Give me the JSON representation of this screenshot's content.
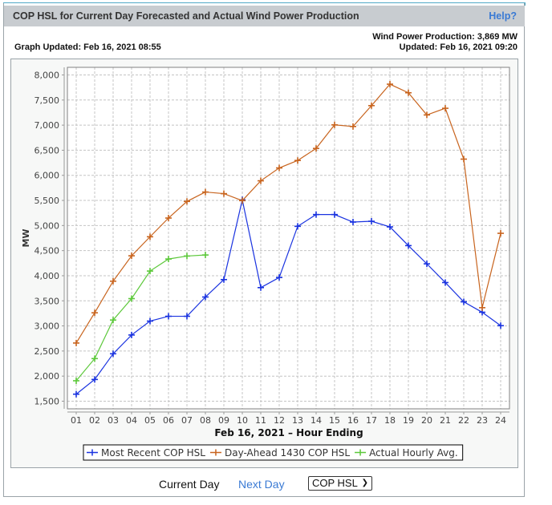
{
  "header": {
    "title": "COP HSL for Current Day Forecasted and Actual Wind Power Production",
    "help_label": "Help?"
  },
  "info": {
    "graph_updated": "Graph Updated: Feb 16, 2021 08:55",
    "wind_production": "Wind Power Production: 3,869 MW",
    "production_updated": "Updated: Feb 16, 2021 09:20"
  },
  "colors": {
    "header_bg": "#c8ccd0",
    "accent_strip": "#4fa8c5",
    "link": "#3a7ad4",
    "series_most_recent": "#1a33e0",
    "series_day_ahead": "#c8641e",
    "series_actual": "#5cc83a"
  },
  "nav": {
    "current_day": "Current Day",
    "next_day": "Next Day",
    "select_value": "COP HSL",
    "select_icon": "chevron-down-icon"
  },
  "chart_data": {
    "type": "line",
    "title": "",
    "xlabel": "Feb 16, 2021 – Hour Ending",
    "ylabel": "MW",
    "ylim": [
      1500,
      8000
    ],
    "yticks": [
      1500,
      2000,
      2500,
      3000,
      3500,
      4000,
      4500,
      5000,
      5500,
      6000,
      6500,
      7000,
      7500,
      8000
    ],
    "ytick_labels": [
      "1,500",
      "2,000",
      "2,500",
      "3,000",
      "3,500",
      "4,000",
      "4,500",
      "5,000",
      "5,500",
      "6,000",
      "6,500",
      "7,000",
      "7,500",
      "8,000"
    ],
    "categories": [
      "01",
      "02",
      "03",
      "04",
      "05",
      "06",
      "07",
      "08",
      "09",
      "10",
      "11",
      "12",
      "13",
      "14",
      "15",
      "16",
      "17",
      "18",
      "19",
      "20",
      "21",
      "22",
      "23",
      "24"
    ],
    "grid": true,
    "legend_position": "bottom",
    "series": [
      {
        "name": "Most Recent COP HSL",
        "color": "#1a33e0",
        "values": [
          1640,
          1933,
          2445,
          2819,
          3096,
          3192,
          3192,
          3576,
          3923,
          5512,
          3763,
          3965,
          4984,
          5219,
          5219,
          5069,
          5085,
          4973,
          4600,
          4237,
          3864,
          3480,
          3272,
          3005
        ]
      },
      {
        "name": "Day-Ahead 1430 COP HSL",
        "color": "#c8641e",
        "values": [
          2659,
          3261,
          3891,
          4397,
          4776,
          5149,
          5480,
          5667,
          5635,
          5496,
          5891,
          6147,
          6296,
          6536,
          7005,
          6973,
          7389,
          7816,
          7645,
          7203,
          7336,
          6323,
          3363,
          4845
        ]
      },
      {
        "name": "Actual Hourly Avg.",
        "color": "#5cc83a",
        "values": [
          1907,
          2349,
          3117,
          3544,
          4093,
          4333,
          4392,
          4413,
          null,
          null,
          null,
          null,
          null,
          null,
          null,
          null,
          null,
          null,
          null,
          null,
          null,
          null,
          null,
          null
        ]
      }
    ]
  }
}
